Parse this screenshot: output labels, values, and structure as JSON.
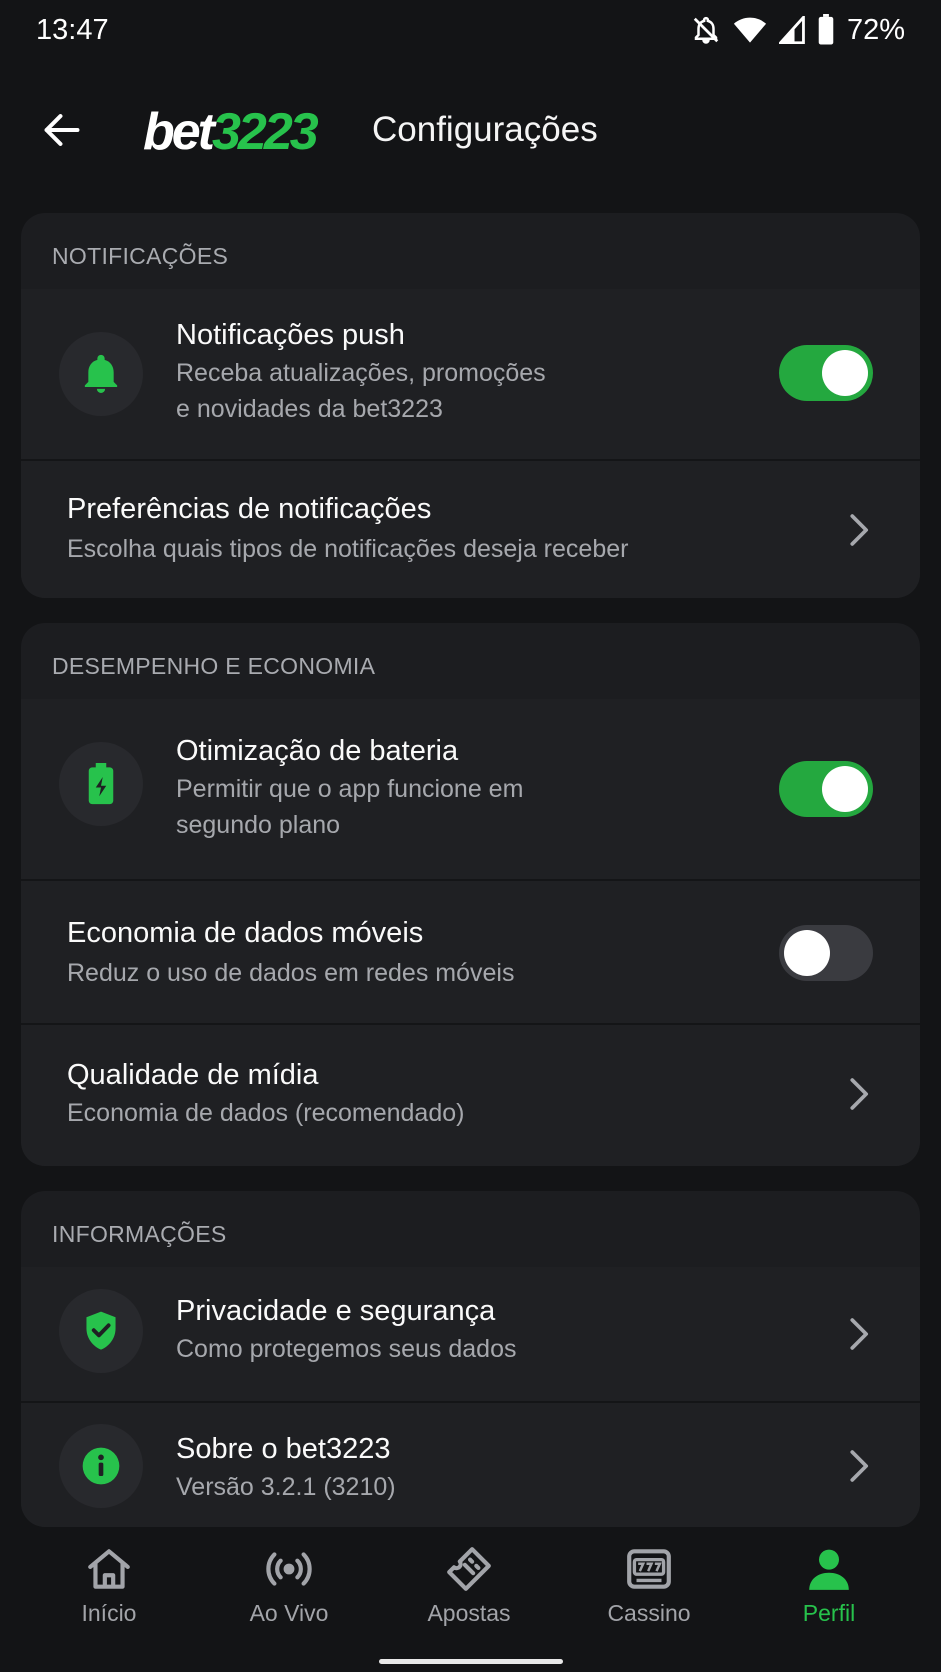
{
  "status_bar": {
    "time": "13:47",
    "battery": "72%"
  },
  "header": {
    "brand_white": "bet",
    "brand_green": "3223",
    "title": "Configurações"
  },
  "sections": {
    "notifications": {
      "label": "NOTIFICAÇÕES",
      "push": {
        "title": "Notificações push",
        "sub1": "Receba atualizações, promoções",
        "sub2": "e novidades da bet3223",
        "enabled": true
      },
      "prefs": {
        "title": "Preferências de notificações",
        "sub": "Escolha quais tipos de notificações deseja receber"
      }
    },
    "performance": {
      "label": "DESEMPENHO E ECONOMIA",
      "battery": {
        "title": "Otimização de bateria",
        "sub1": "Permitir que o app funcione em",
        "sub2": "segundo plano",
        "enabled": true
      },
      "data_saver": {
        "title": "Economia de dados móveis",
        "sub": "Reduz o uso de dados em redes móveis",
        "enabled": false
      },
      "media": {
        "title": "Qualidade de mídia",
        "sub": "Economia de dados (recomendado)"
      }
    },
    "info": {
      "label": "INFORMAÇÕES",
      "privacy": {
        "title": "Privacidade e segurança",
        "sub": "Como protegemos seus dados"
      },
      "about": {
        "title": "Sobre o bet3223",
        "sub": "Versão 3.2.1 (3210)"
      }
    }
  },
  "bottom_nav": {
    "items": [
      {
        "label": "Início",
        "icon": "home-icon"
      },
      {
        "label": "Ao Vivo",
        "icon": "live-broadcast-icon"
      },
      {
        "label": "Apostas",
        "icon": "ticket-icon"
      },
      {
        "label": "Cassino",
        "icon": "slot-machine-icon"
      },
      {
        "label": "Perfil",
        "icon": "person-icon"
      }
    ],
    "active": "Perfil"
  },
  "colors": {
    "accent": "#27c24c",
    "toggle_on": "#24a83f",
    "background": "#131416",
    "card": "#1f2023"
  }
}
